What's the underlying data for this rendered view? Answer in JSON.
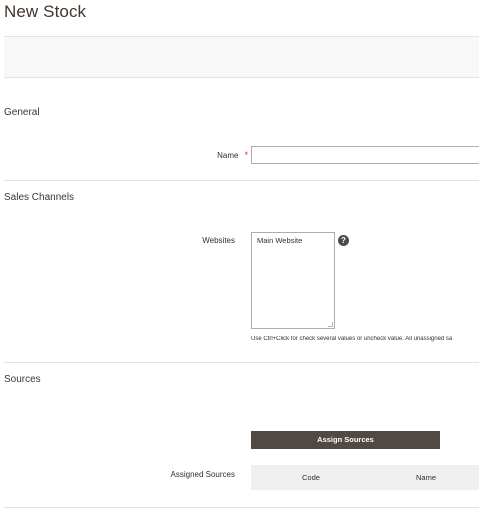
{
  "page": {
    "title": "New Stock"
  },
  "general": {
    "title": "General",
    "name_label": "Name",
    "required_mark": "*",
    "name_value": ""
  },
  "sales_channels": {
    "title": "Sales Channels",
    "websites_label": "Websites",
    "websites_options": [
      "Main Website"
    ],
    "help_icon": "question-circle-icon",
    "help_glyph": "?",
    "note": "Use Ctrl+Click for check several values or uncheck value. All unassigned sa"
  },
  "sources": {
    "title": "Sources",
    "assign_button": "Assign Sources",
    "assigned_label": "Assigned Sources",
    "columns": [
      "Code",
      "Name"
    ]
  },
  "colors": {
    "button_bg": "#514943",
    "required": "#e22626",
    "grid_header_bg": "#efefef"
  }
}
